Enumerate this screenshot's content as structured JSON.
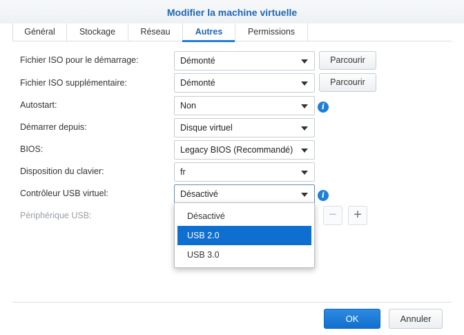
{
  "dialog": {
    "title": "Modifier la machine virtuelle"
  },
  "tabs": [
    {
      "label": "Général"
    },
    {
      "label": "Stockage"
    },
    {
      "label": "Réseau"
    },
    {
      "label": "Autres"
    },
    {
      "label": "Permissions"
    }
  ],
  "active_tab": "Autres",
  "rows": [
    {
      "label": "Fichier ISO pour le démarrage:",
      "value": "Démonté",
      "button": "Parcourir"
    },
    {
      "label": "Fichier ISO supplémentaire:",
      "value": "Démonté",
      "button": "Parcourir"
    },
    {
      "label": "Autostart:",
      "value": "Non"
    },
    {
      "label": "Démarrer depuis:",
      "value": "Disque virtuel"
    },
    {
      "label": "BIOS:",
      "value": "Legacy BIOS (Recommandé)"
    },
    {
      "label": "Disposition du clavier:",
      "value": "fr"
    },
    {
      "label": "Contrôleur USB virtuel:",
      "value": "Désactivé"
    },
    {
      "label": "Périphérique USB:"
    }
  ],
  "usb_dropdown": {
    "options": [
      "Désactivé",
      "USB 2.0",
      "USB 3.0"
    ],
    "highlighted": "USB 2.0"
  },
  "footer": {
    "ok_label": "OK",
    "cancel_label": "Annuler"
  },
  "colors": {
    "accent": "#1f7fd6",
    "title": "#1f66b3",
    "highlight": "#0f6fd1"
  }
}
